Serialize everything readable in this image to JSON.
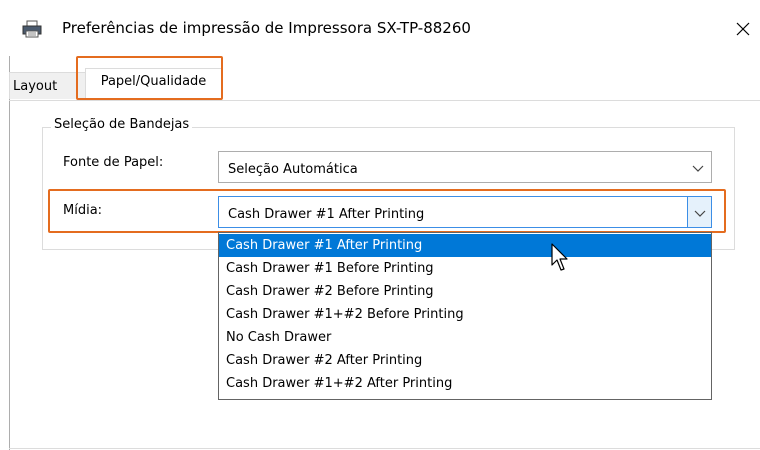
{
  "window": {
    "title": "Preferências de impressão de Impressora SX-TP-88260"
  },
  "tabs": [
    {
      "label": "Layout"
    },
    {
      "label": "Papel/Qualidade"
    }
  ],
  "group": {
    "title": "Seleção de Bandejas"
  },
  "paper_source": {
    "label": "Fonte de Papel:",
    "value": "Seleção Automática"
  },
  "media": {
    "label": "Mídia:",
    "value": "Cash Drawer #1 After Printing",
    "options": [
      "Cash Drawer #1 After Printing",
      "Cash Drawer #1 Before Printing",
      "Cash Drawer #2 Before Printing",
      "Cash Drawer #1+#2 Before Printing",
      "No Cash Drawer",
      "Cash Drawer #2 After Printing",
      "Cash Drawer #1+#2 After Printing"
    ],
    "selected_index": 0
  },
  "colors": {
    "highlight_outline": "#e46c1f",
    "selection": "#0078d7",
    "focus_border": "#3c8ee6"
  },
  "icons": {
    "title": "printer-icon",
    "close": "close-icon",
    "dropdown": "chevron-down-icon",
    "cursor": "mouse-pointer-icon"
  }
}
